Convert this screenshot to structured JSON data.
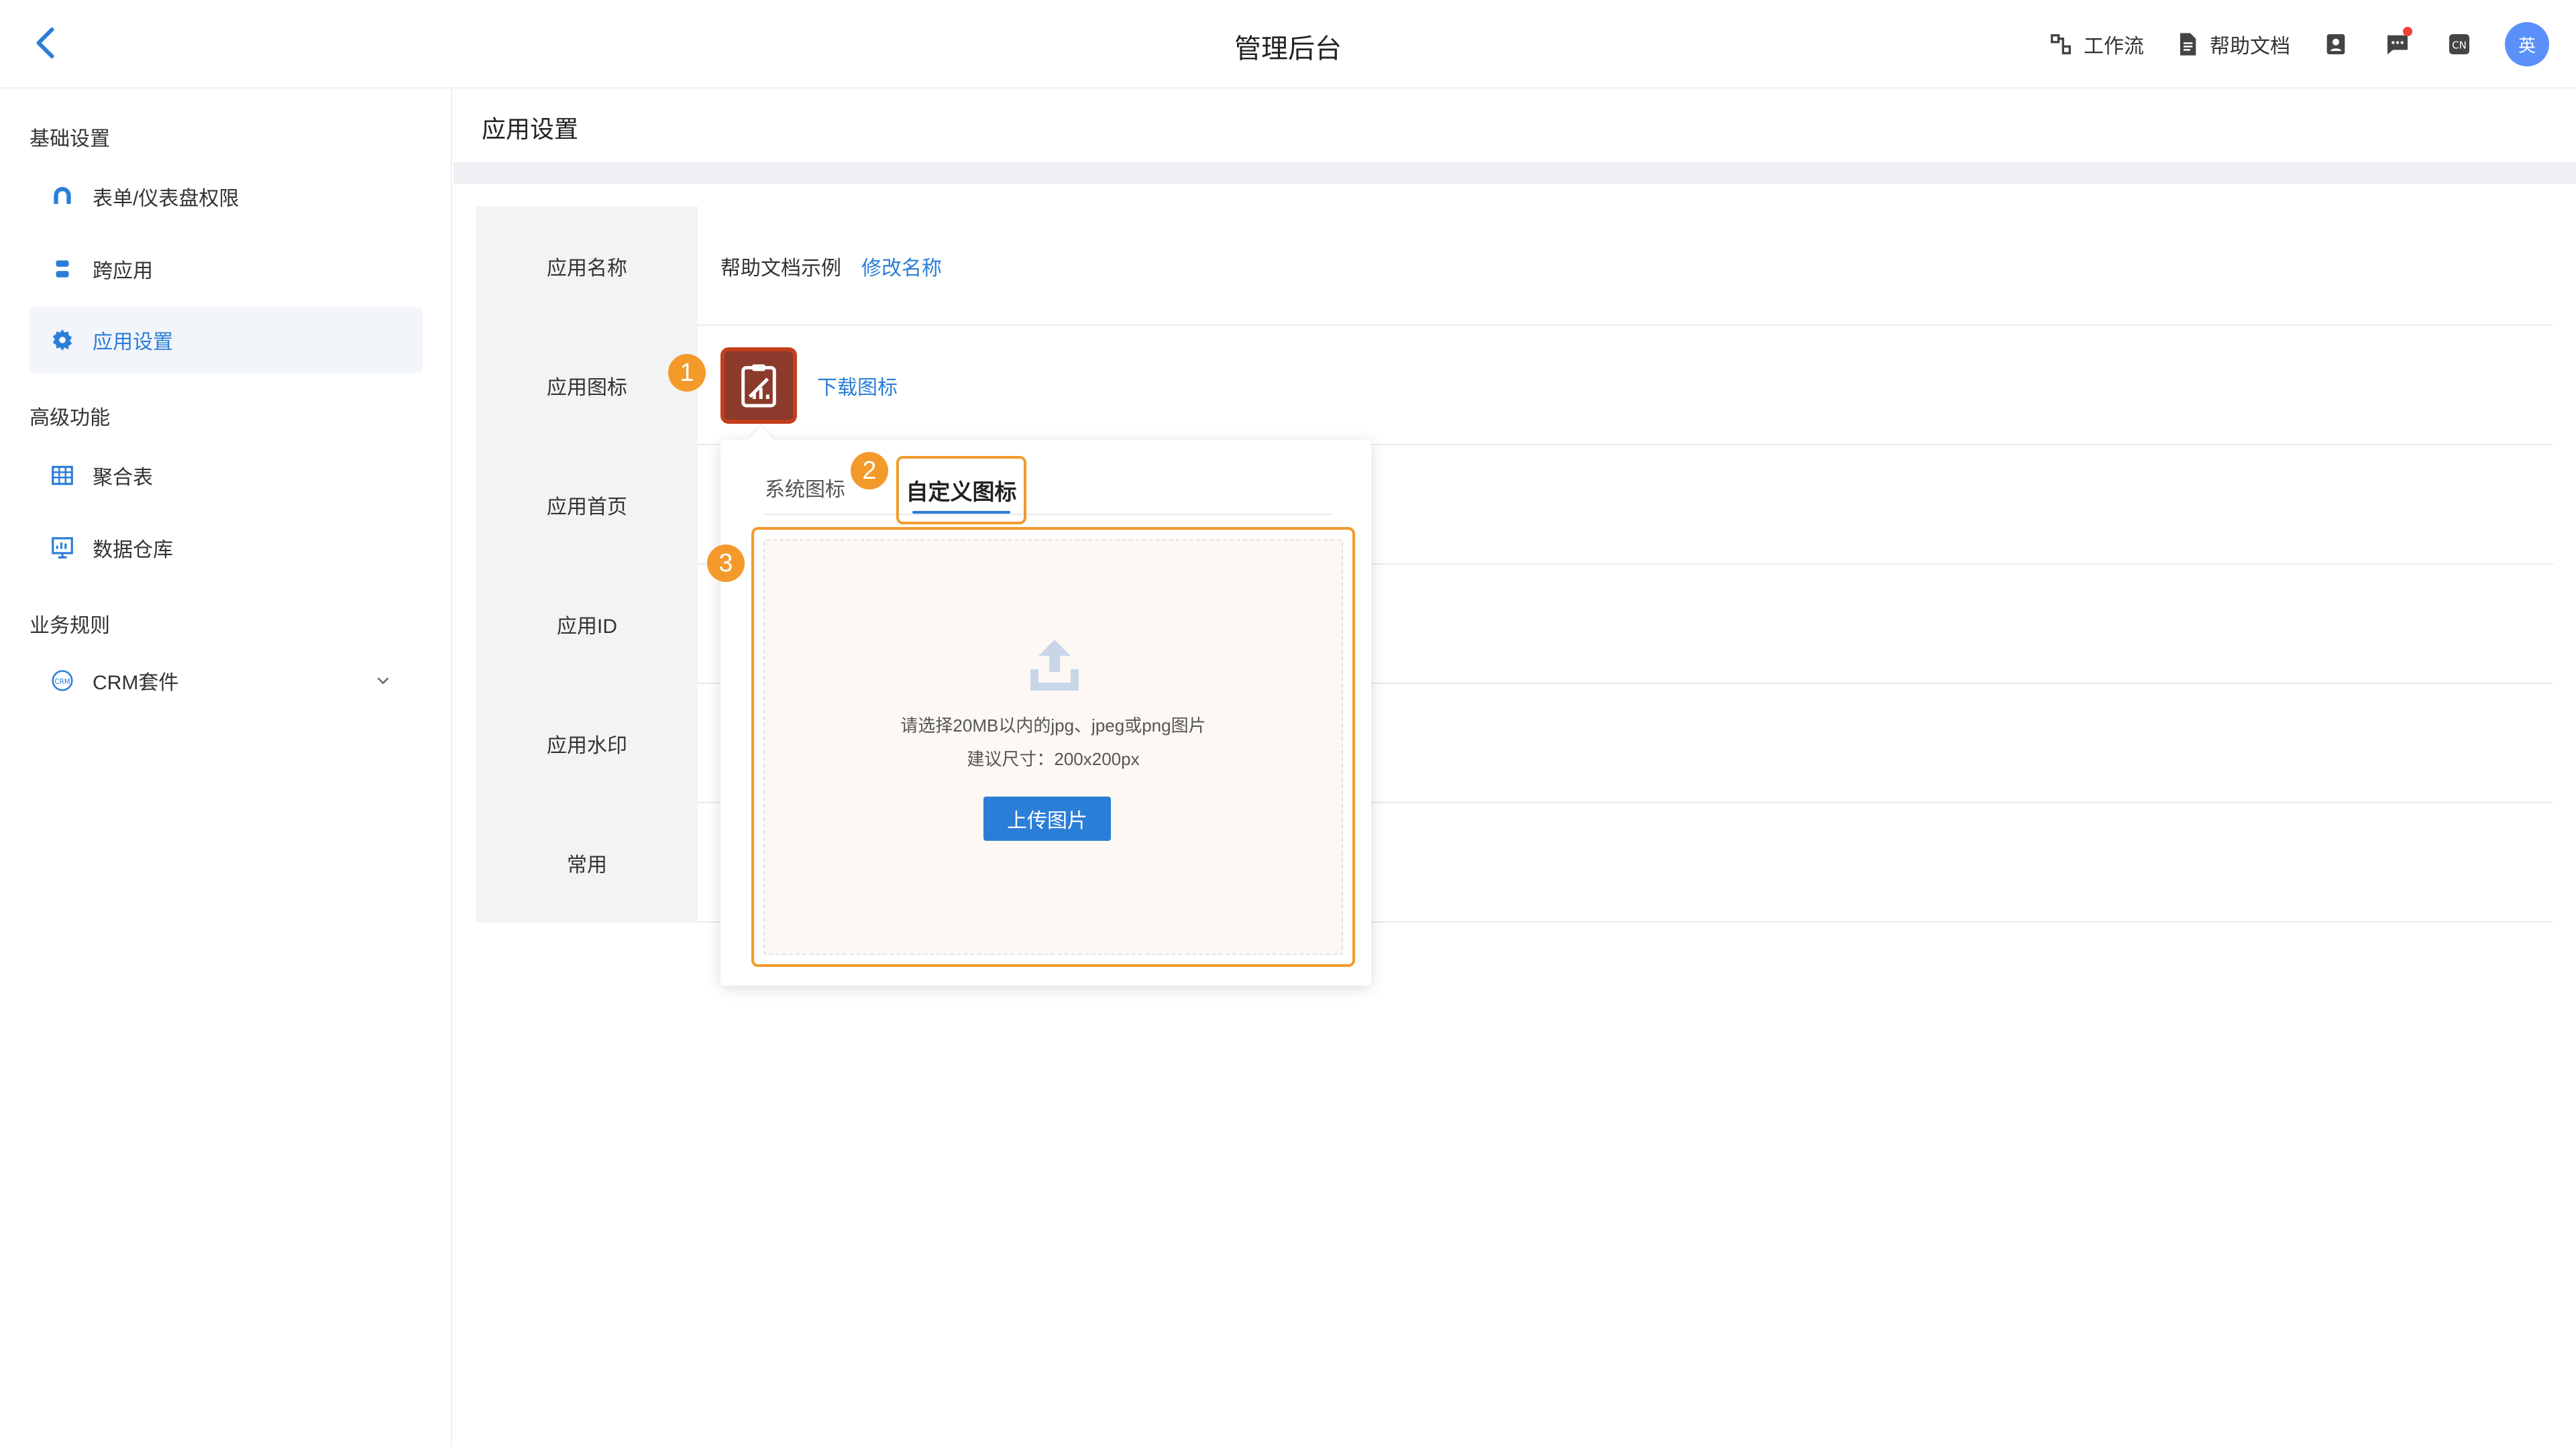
{
  "header": {
    "title": "管理后台",
    "workflow_label": "工作流",
    "help_docs_label": "帮助文档",
    "avatar_text": "英"
  },
  "sidebar": {
    "groups": [
      {
        "title": "基础设置",
        "items": [
          {
            "label": "表单/仪表盘权限",
            "icon": "permission-icon"
          },
          {
            "label": "跨应用",
            "icon": "cross-app-icon"
          },
          {
            "label": "应用设置",
            "icon": "gear-icon",
            "active": true
          }
        ]
      },
      {
        "title": "高级功能",
        "items": [
          {
            "label": "聚合表",
            "icon": "table-icon"
          },
          {
            "label": "数据仓库",
            "icon": "data-warehouse-icon"
          }
        ]
      },
      {
        "title": "业务规则",
        "items": [
          {
            "label": "CRM套件",
            "icon": "crm-icon",
            "expandable": true
          }
        ]
      }
    ]
  },
  "main": {
    "page_title": "应用设置",
    "rows": [
      {
        "label": "应用名称",
        "value": "帮助文档示例",
        "action": "修改名称"
      },
      {
        "label": "应用图标",
        "action": "下载图标"
      },
      {
        "label": "应用首页"
      },
      {
        "label": "应用ID"
      },
      {
        "label": "应用水印"
      },
      {
        "label": "常用"
      }
    ]
  },
  "popover": {
    "tabs": [
      "系统图标",
      "自定义图标"
    ],
    "active_tab": "自定义图标",
    "upload_hint": "请选择20MB以内的jpg、jpeg或png图片",
    "upload_size": "建议尺寸：200x200px",
    "upload_button": "上传图片"
  },
  "markers": [
    "1",
    "2",
    "3"
  ],
  "colors": {
    "accent": "#2a7ed8",
    "marker": "#f39a2b",
    "app_icon_bg": "#8b3a2b",
    "app_icon_border": "#c33e1c",
    "notification_dot": "#f04134"
  }
}
